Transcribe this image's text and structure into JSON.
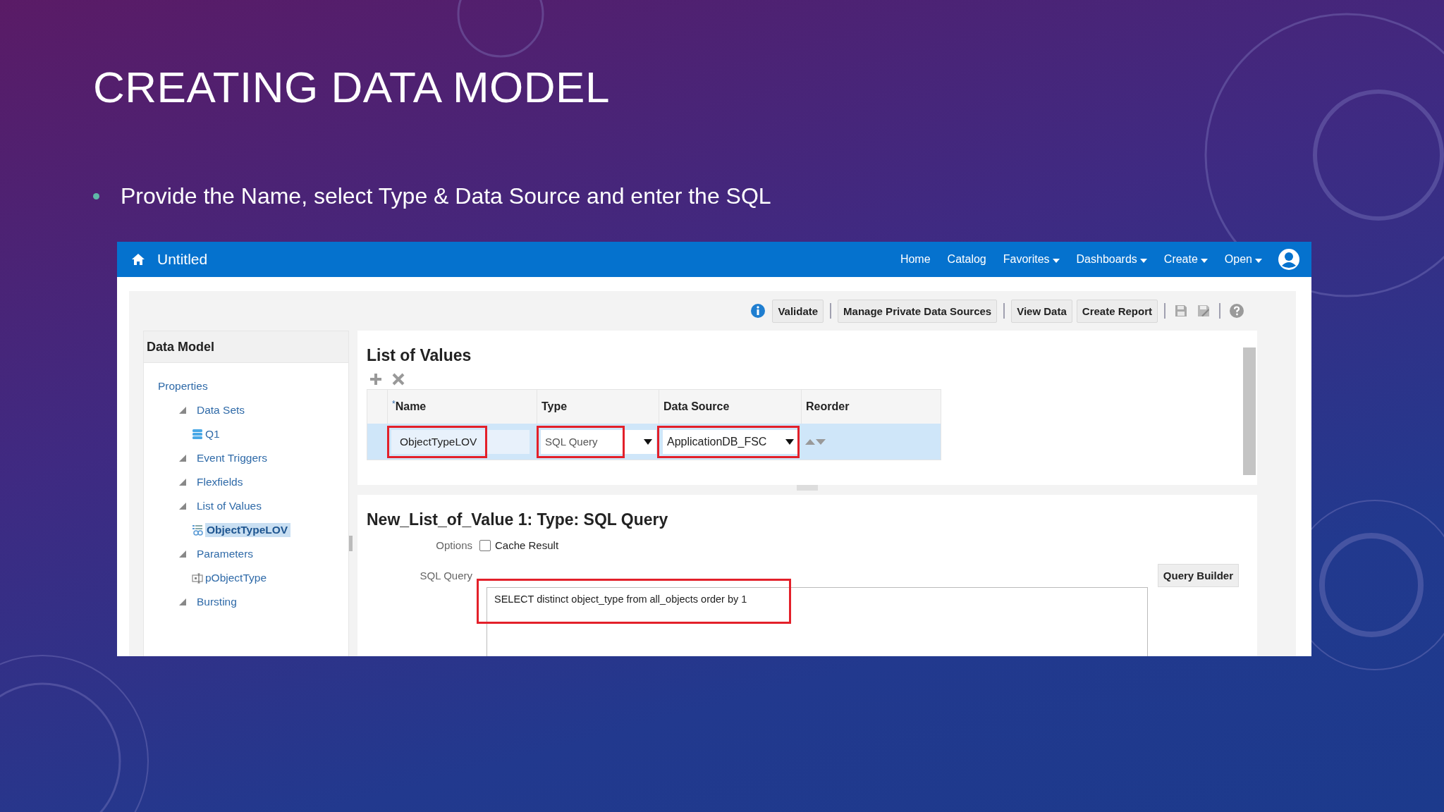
{
  "slide": {
    "title": "CREATING DATA MODEL",
    "bullets": [
      "Provide the Name, select Type & Data Source and enter the SQL"
    ]
  },
  "app": {
    "header": {
      "title": "Untitled",
      "nav": [
        {
          "label": "Home",
          "dropdown": false
        },
        {
          "label": "Catalog",
          "dropdown": false
        },
        {
          "label": "Favorites",
          "dropdown": true
        },
        {
          "label": "Dashboards",
          "dropdown": true
        },
        {
          "label": "Create",
          "dropdown": true
        },
        {
          "label": "Open",
          "dropdown": true
        }
      ]
    },
    "toolbar": {
      "buttons": [
        "Validate",
        "Manage Private Data Sources",
        "View Data",
        "Create Report"
      ]
    },
    "sidebar": {
      "title": "Data Model",
      "tree": [
        {
          "label": "Properties",
          "kind": "link",
          "selected": false
        },
        {
          "label": "Data Sets",
          "kind": "folder",
          "expanded": true,
          "selected": false,
          "children": [
            {
              "label": "Q1",
              "kind": "dataset",
              "selected": false
            }
          ]
        },
        {
          "label": "Event Triggers",
          "kind": "folder",
          "expanded": true,
          "selected": false
        },
        {
          "label": "Flexfields",
          "kind": "folder",
          "expanded": true,
          "selected": false
        },
        {
          "label": "List of Values",
          "kind": "folder",
          "expanded": true,
          "selected": false,
          "children": [
            {
              "label": "ObjectTypeLOV",
              "kind": "lov",
              "selected": true
            }
          ]
        },
        {
          "label": "Parameters",
          "kind": "folder",
          "expanded": true,
          "selected": false,
          "children": [
            {
              "label": "pObjectType",
              "kind": "parameter",
              "selected": false
            }
          ]
        },
        {
          "label": "Bursting",
          "kind": "folder",
          "expanded": true,
          "selected": false
        }
      ]
    },
    "lov": {
      "title": "List of Values",
      "columns": [
        {
          "label": "Name",
          "marker": "*"
        },
        {
          "label": "Type"
        },
        {
          "label": "Data Source"
        },
        {
          "label": "Reorder"
        }
      ],
      "rows": [
        {
          "selected": true,
          "name": {
            "value": "ObjectTypeLOV",
            "highlighted": true
          },
          "type": {
            "value": "SQL Query",
            "highlighted": true
          },
          "data_source": {
            "value": "ApplicationDB_FSC",
            "highlighted": true
          }
        }
      ]
    },
    "detail": {
      "title": "New_List_of_Value 1: Type: SQL Query",
      "options_label": "Options",
      "cache_result": {
        "label": "Cache Result",
        "checked": false
      },
      "sql_label": "SQL Query",
      "query_builder": "Query Builder",
      "sql": {
        "value": "SELECT distinct object_type from all_objects order by 1",
        "highlighted": true
      }
    }
  }
}
